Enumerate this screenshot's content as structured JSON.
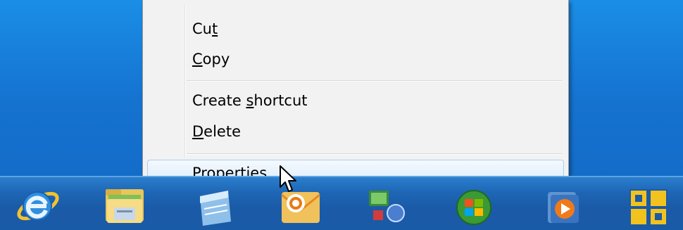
{
  "context_menu": {
    "items": [
      {
        "pre": "Cu",
        "key": "t",
        "post": ""
      },
      {
        "pre": "",
        "key": "C",
        "post": "opy"
      },
      {
        "pre": "Create ",
        "key": "s",
        "post": "hortcut"
      },
      {
        "pre": "",
        "key": "D",
        "post": "elete"
      },
      {
        "pre": "P",
        "key": "r",
        "post": "operties"
      }
    ],
    "highlighted_item": "Properties"
  },
  "taskbar": {
    "pinned_icons": [
      "internet-explorer-icon",
      "file-explorer-icon",
      "notepad-icon",
      "outlook-icon",
      "network-icon",
      "windows-media-center-icon",
      "media-player-icon",
      "vmware-icon"
    ]
  },
  "colors": {
    "desktop_blue": "#1572cf",
    "menu_background": "#f2f2f2",
    "highlight_border": "#aecdeb"
  }
}
